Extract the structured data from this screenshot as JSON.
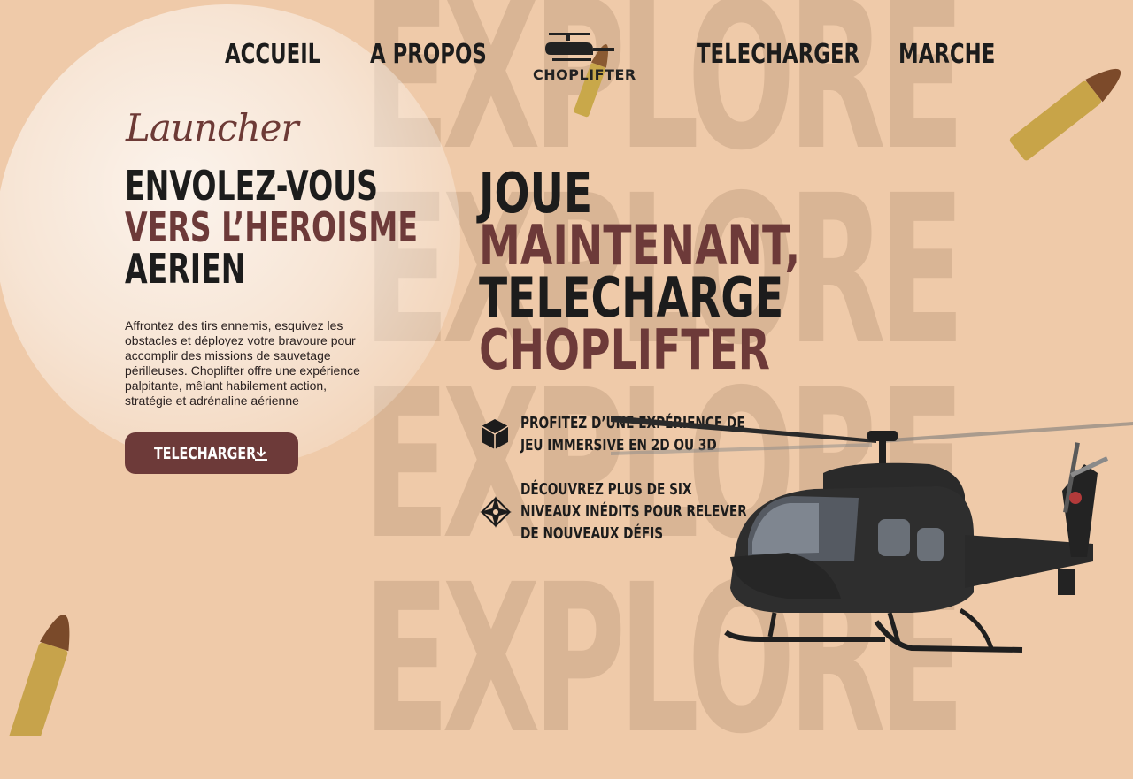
{
  "background": {
    "watermark_words": [
      "EXPLORE",
      "EXPLORE",
      "EXPLORE",
      "EXPLORE"
    ]
  },
  "nav": {
    "items": [
      "ACCUEIL",
      "A PROPOS",
      "TELECHARGER",
      "MARCHE"
    ]
  },
  "logo": {
    "text": "CHOPLIFTER",
    "icon": "helicopter-logo-icon"
  },
  "hero_left": {
    "script_title": "Launcher",
    "headline": [
      "ENVOLEZ-VOUS",
      "VERS  L’HEROISME",
      "AERIEN"
    ],
    "description": "Affrontez des tirs ennemis, esquivez les obstacles et déployez votre bravoure pour accomplir des missions de sauvetage périlleuses. Choplifter offre une expérience palpitante, mêlant habilement action, stratégie et adrénaline aérienne",
    "button_label": "TELECHARGER",
    "button_icon": "download-icon"
  },
  "hero_right": {
    "headline": [
      "JOUE",
      "MAINTENANT,",
      "TELECHARGE",
      "CHOPLIFTER"
    ],
    "features": [
      {
        "icon": "cube-icon",
        "lines": [
          "PROFITEZ  D’UNE EXPÉRIENCE DE",
          "JEU IMMERSIVE EN 2D OU 3D"
        ]
      },
      {
        "icon": "compass-star-icon",
        "lines": [
          "DÉCOUVREZ PLUS DE SIX",
          "NIVEAUX INÉDITS POUR RELEVER",
          "DE NOUVEAUX DÉFIS"
        ]
      }
    ]
  },
  "colors": {
    "background": "#efcaa9",
    "watermark": "#d9b595",
    "accent_maroon": "#6d3a39",
    "text_dark": "#1c1c1c"
  },
  "decorations": [
    "bullet-icon",
    "bullet-icon",
    "bullet-icon",
    "helicopter-image"
  ]
}
